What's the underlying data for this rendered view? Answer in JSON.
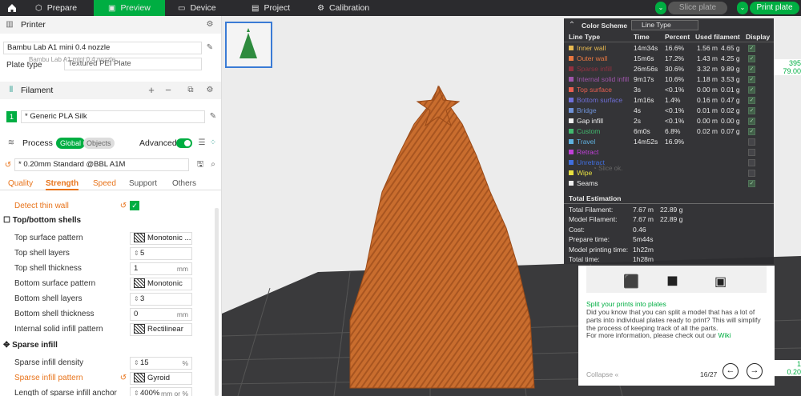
{
  "topbar": {
    "tabs": [
      {
        "label": "Prepare"
      },
      {
        "label": "Preview"
      },
      {
        "label": "Device"
      },
      {
        "label": "Project"
      },
      {
        "label": "Calibration"
      }
    ],
    "slice_label": "Slice plate",
    "print_label": "Print plate"
  },
  "sidebar": {
    "printer": {
      "title": "Printer",
      "name": "Bambu Lab A1 mini 0.4 nozzle",
      "plate_label": "Plate type",
      "plate_value": "Textured PEI Plate",
      "plate_overlay": "Bambu Lab A1 mini 0.4 nozzle"
    },
    "filament": {
      "title": "Filament",
      "index": "1",
      "value": "* Generic PLA Silk"
    },
    "process": {
      "title": "Process",
      "global_label": "Global",
      "objects_label": "Objects",
      "advanced_label": "Advanced",
      "preset": "* 0.20mm Standard @BBL A1M"
    },
    "tabs": [
      "Quality",
      "Strength",
      "Speed",
      "Support",
      "Others"
    ],
    "detect_thin_wall": "Detect thin wall",
    "top_bottom": {
      "title": "Top/bottom shells",
      "rows": [
        {
          "label": "Top surface pattern",
          "value": "Monotonic ...",
          "unit": ""
        },
        {
          "label": "Top shell layers",
          "value": "5",
          "unit": ""
        },
        {
          "label": "Top shell thickness",
          "value": "1",
          "unit": "mm"
        },
        {
          "label": "Bottom surface pattern",
          "value": "Monotonic",
          "unit": ""
        },
        {
          "label": "Bottom shell layers",
          "value": "3",
          "unit": ""
        },
        {
          "label": "Bottom shell thickness",
          "value": "0",
          "unit": "mm"
        },
        {
          "label": "Internal solid infill pattern",
          "value": "Rectilinear",
          "unit": ""
        }
      ]
    },
    "sparse": {
      "title": "Sparse infill",
      "rows": [
        {
          "label": "Sparse infill density",
          "value": "15",
          "unit": "%"
        },
        {
          "label": "Sparse infill pattern",
          "value": "Gyroid",
          "unit": ""
        },
        {
          "label": "Length of sparse infill anchor",
          "value": "400%",
          "unit": "mm or %"
        }
      ]
    }
  },
  "legend": {
    "title": "Color Scheme",
    "scheme": "Line Type",
    "headers": [
      "Line Type",
      "Time",
      "Percent",
      "Used filament",
      "Display"
    ],
    "rows": [
      {
        "name": "Inner wall",
        "time": "14m34s",
        "percent": "16.6%",
        "len": "1.56 m",
        "weight": "4.65 g",
        "color": "#e8b84a",
        "on": true
      },
      {
        "name": "Outer wall",
        "time": "15m6s",
        "percent": "17.2%",
        "len": "1.43 m",
        "weight": "4.25 g",
        "color": "#e8733a",
        "on": true
      },
      {
        "name": "Sparse infill",
        "time": "26m56s",
        "percent": "30.6%",
        "len": "3.32 m",
        "weight": "9.89 g",
        "color": "#8f2a3a",
        "on": true
      },
      {
        "name": "Internal solid infill",
        "time": "9m17s",
        "percent": "10.6%",
        "len": "1.18 m",
        "weight": "3.53 g",
        "color": "#9b4fa8",
        "on": true
      },
      {
        "name": "Top surface",
        "time": "3s",
        "percent": "<0.1%",
        "len": "0.00 m",
        "weight": "0.01 g",
        "color": "#e85a4a",
        "on": true
      },
      {
        "name": "Bottom surface",
        "time": "1m16s",
        "percent": "1.4%",
        "len": "0.16 m",
        "weight": "0.47 g",
        "color": "#6a6ad8",
        "on": true
      },
      {
        "name": "Bridge",
        "time": "4s",
        "percent": "<0.1%",
        "len": "0.01 m",
        "weight": "0.02 g",
        "color": "#6a8fd8",
        "on": true
      },
      {
        "name": "Gap infill",
        "time": "2s",
        "percent": "<0.1%",
        "len": "0.00 m",
        "weight": "0.00 g",
        "color": "#f0f0f0",
        "on": true
      },
      {
        "name": "Custom",
        "time": "6m0s",
        "percent": "6.8%",
        "len": "0.02 m",
        "weight": "0.07 g",
        "color": "#3cb86a",
        "on": true
      },
      {
        "name": "Travel",
        "time": "14m52s",
        "percent": "16.9%",
        "len": "",
        "weight": "",
        "color": "#5ab0e0",
        "on": false
      },
      {
        "name": "Retract",
        "time": "",
        "percent": "",
        "len": "",
        "weight": "",
        "color": "#c03ad8",
        "on": false
      },
      {
        "name": "Unretract",
        "time": "",
        "percent": "",
        "len": "",
        "weight": "",
        "color": "#3a6ae0",
        "on": false
      },
      {
        "name": "Wipe",
        "time": "",
        "percent": "",
        "len": "",
        "weight": "",
        "color": "#e8e03a",
        "on": false
      },
      {
        "name": "Seams",
        "time": "",
        "percent": "",
        "len": "",
        "weight": "",
        "color": "#f0f0f0",
        "on": true
      }
    ],
    "total_title": "Total Estimation",
    "totals": [
      {
        "label": "Total Filament:",
        "a": "7.67 m",
        "b": "22.89 g"
      },
      {
        "label": "Model Filament:",
        "a": "7.67 m",
        "b": "22.89 g"
      },
      {
        "label": "Cost:",
        "a": "0.46",
        "b": ""
      },
      {
        "label": "Prepare time:",
        "a": "5m44s",
        "b": ""
      },
      {
        "label": "Model printing time:",
        "a": "1h22m",
        "b": ""
      },
      {
        "label": "Total time:",
        "a": "1h28m",
        "b": ""
      }
    ]
  },
  "tip": {
    "title": "Split your prints into plates",
    "body": "Did you know that you can split a model that has a lot of parts into individual plates ready to print? This will simplify the process of keeping track of all the parts.",
    "more": "For more information, please check out our",
    "wiki": "Wiki",
    "collapse": "Collapse",
    "page": "16/27",
    "slice_ok": "Slice ok."
  },
  "edge": {
    "top1": "395",
    "top2": "79.00",
    "bot1": "1",
    "bot2": "0.20"
  }
}
